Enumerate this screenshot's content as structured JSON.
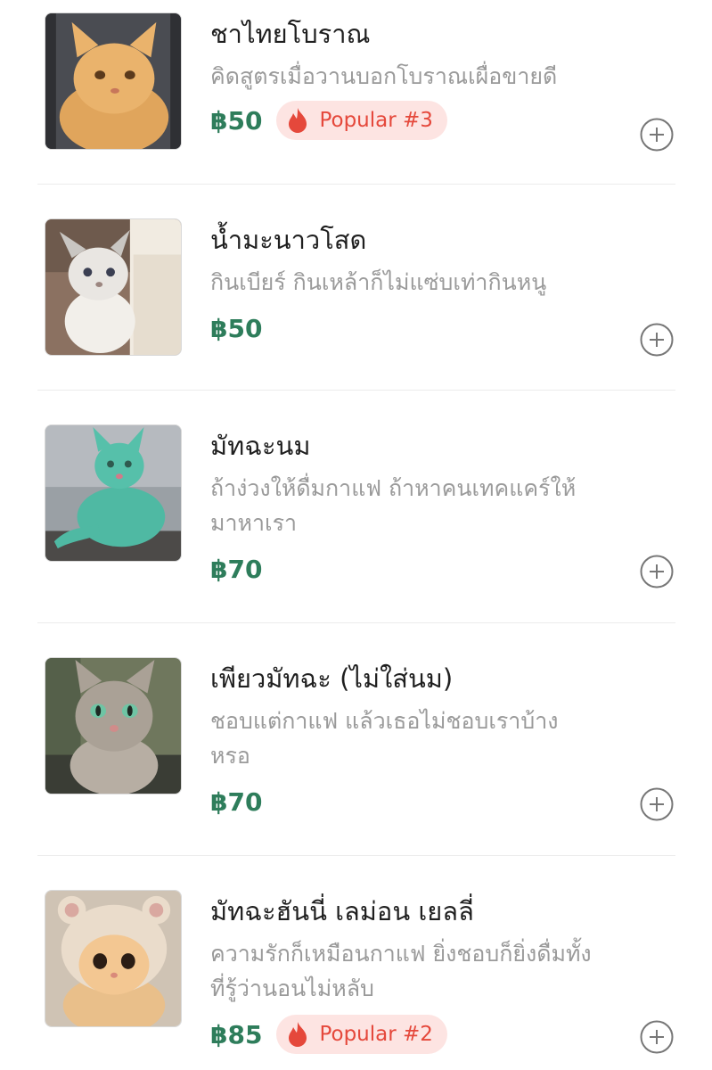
{
  "currency_symbol": "฿",
  "icons": {
    "add": "plus-circle-icon",
    "popular": "flame-icon"
  },
  "colors": {
    "price": "#2e7d5b",
    "badge_bg": "#fde4e2",
    "badge_text": "#e5483b",
    "title": "#1f1f1f",
    "description": "#9a9a9a"
  },
  "menu": {
    "items": [
      {
        "title": "ชาไทยโบราณ",
        "description": "คิดสูตรเมื่อวานบอกโบราณเผื่อขายดี",
        "price": "฿50",
        "badge": "Popular #3"
      },
      {
        "title": "น้ำมะนาวโสด",
        "description": "กินเบียร์ กินเหล้าก็ไม่แซ่บเท่ากินหนู",
        "price": "฿50",
        "badge": ""
      },
      {
        "title": "มัทฉะนม",
        "description": "ถ้าง่วงให้ดื่มกาแฟ ถ้าหาคนเทคแคร์ให้มาหาเรา",
        "price": "฿70",
        "badge": ""
      },
      {
        "title": "เพียวมัทฉะ (ไม่ใส่นม)",
        "description": "ชอบแต่กาแฟ แล้วเธอไม่ชอบเราบ้างหรอ",
        "price": "฿70",
        "badge": ""
      },
      {
        "title": "มัทฉะฮันนี่ เลม่อน เยลลี่",
        "description": "ความรักก็เหมือนกาแฟ ยิ่งชอบก็ยิ่งดื่มทั้งที่รู้ว่านอนไม่หลับ",
        "price": "฿85",
        "badge": "Popular #2"
      }
    ]
  }
}
